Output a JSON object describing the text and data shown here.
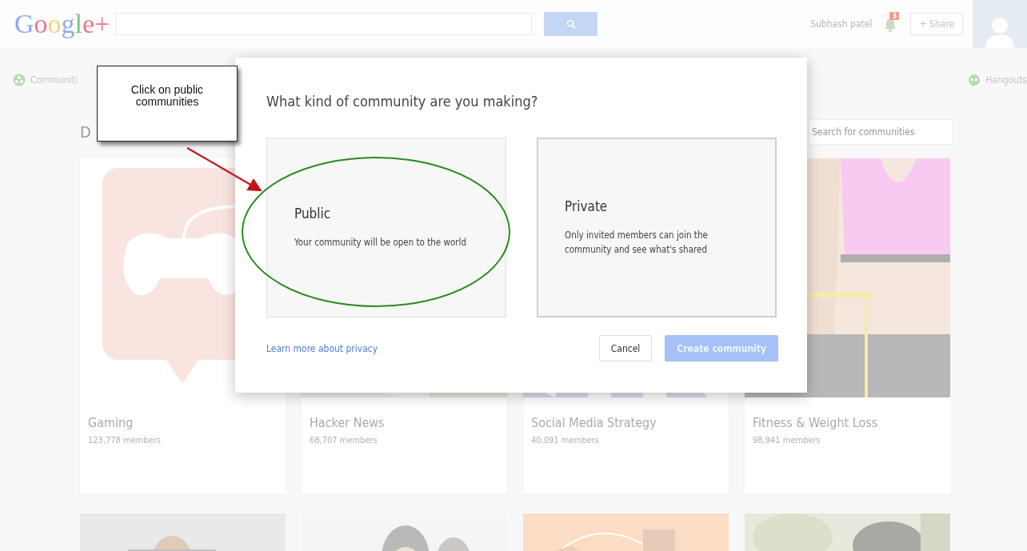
{
  "topbar": {
    "logo": "Google+",
    "user_name": "Subhash patel",
    "notification_count": "3",
    "share_button": "+ Share"
  },
  "nav": {
    "communities": "Communiti",
    "hangouts": "Hangouts"
  },
  "heading": "D",
  "community_search": {
    "placeholder": "Search for communities"
  },
  "communities": [
    {
      "name": "Gaming",
      "members": "123,778 members",
      "kind": "picture"
    },
    {
      "name": "Hacker News",
      "members": "68,707 members",
      "kind": "picture"
    },
    {
      "name": "Social Media Strategy",
      "members": "40,091 members",
      "kind": "picture"
    },
    {
      "name": "Fitness & Weight Loss",
      "members": "98,941 members",
      "kind": "picture"
    }
  ],
  "dialog": {
    "title": "What kind of community are you making?",
    "options": [
      {
        "title": "Public",
        "description": "Your community will be open to the world",
        "selected": false
      },
      {
        "title": "Private",
        "description": "Only invited members can join the community and see what's shared",
        "selected": true
      }
    ],
    "link": "Learn more about privacy",
    "buttons": [
      {
        "label": "Cancel",
        "kind": "secondary"
      },
      {
        "label": "Create community",
        "kind": "primary"
      }
    ]
  },
  "annotation": {
    "callout": "Click on public communities"
  }
}
